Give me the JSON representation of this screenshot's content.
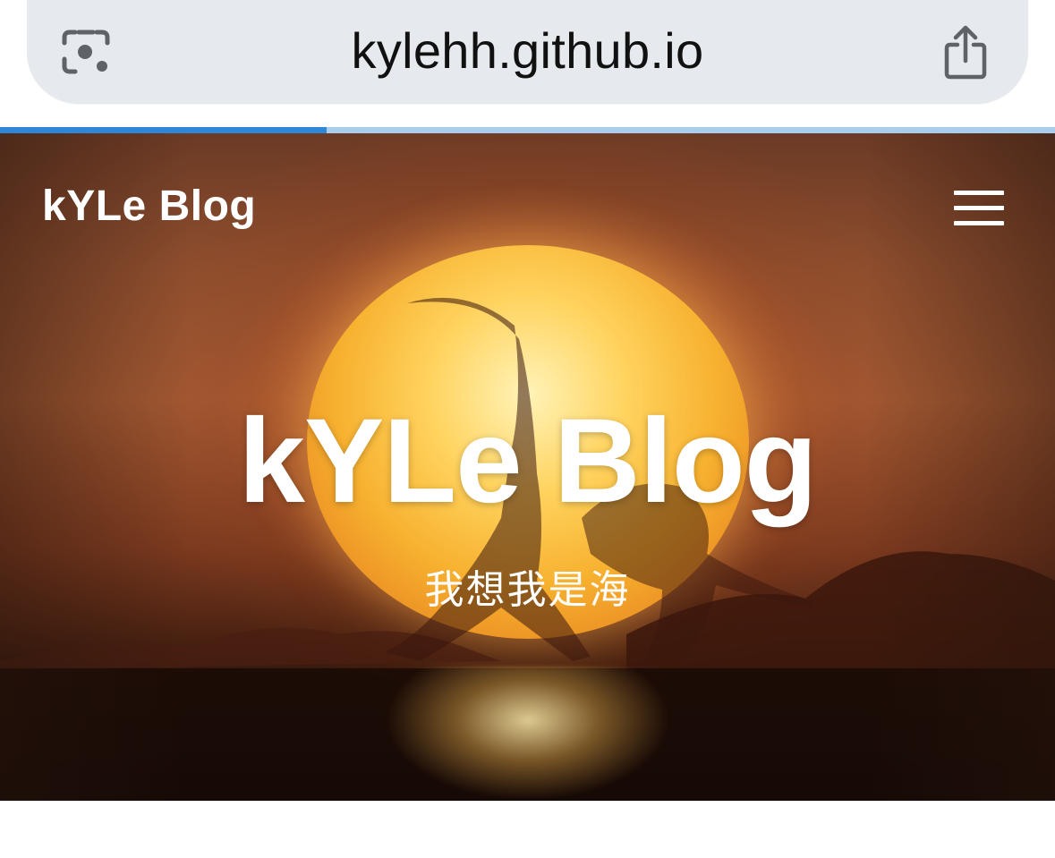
{
  "browser": {
    "url": "kylehh.github.io",
    "left_icon": "camera-search-icon",
    "right_icon": "share-icon",
    "load_progress": 0.31,
    "colors": {
      "pill": "#e6e9ed",
      "progress_fill": "#2f86d6",
      "progress_track": "#a9cdec"
    }
  },
  "site": {
    "brand": "kYLe Blog",
    "menu_icon": "hamburger-menu-icon",
    "hero": {
      "title": "kYLe Blog",
      "subtitle": "我想我是海"
    }
  }
}
